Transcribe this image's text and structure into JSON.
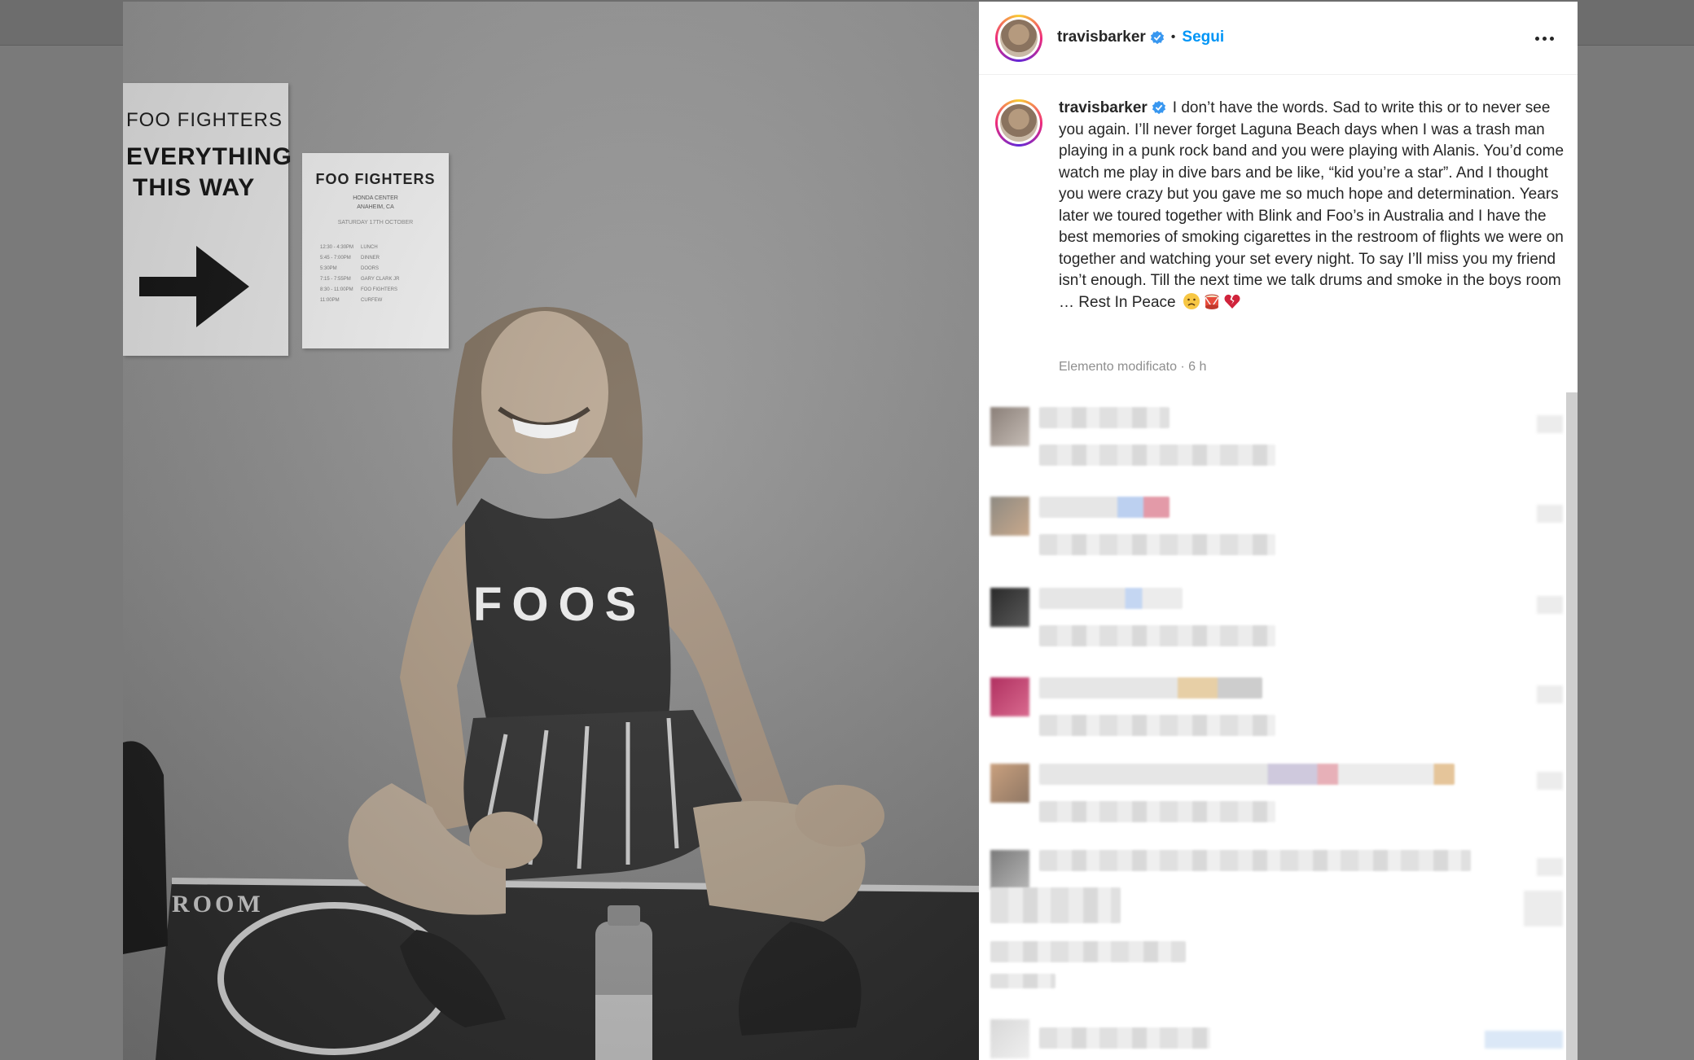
{
  "post": {
    "username": "travisbarker",
    "follow_label": "Segui",
    "separator": "•",
    "caption": "I don’t have the words. Sad to write this or to never see you again. I’ll never forget Laguna Beach days when I was a trash man playing in a punk rock band and you were playing with Alanis. You’d come watch me play in dive bars and be like, “kid you’re a star”. And I thought you were crazy but you gave me so much hope and determination. Years later we toured together with Blink and Foo’s in Australia and I have the best memories of smoking cigarettes in the restroom of flights we were on together and watching your set every night. To say I’ll miss you my friend isn’t enough. Till the next time we talk drums and smoke in the boys room … Rest In Peace",
    "timestamp": "Elemento modificato · 6 h"
  },
  "photo": {
    "poster_left": {
      "band": "FOO FIGHTERS",
      "line2": "EVERYTHING",
      "line3": "THIS WAY"
    },
    "poster_right": {
      "title": "FOO FIGHTERS",
      "venue": "HONDA CENTER",
      "city": "ANAHEIM, CA",
      "date": "SATURDAY 17TH OCTOBER",
      "schedule": [
        {
          "time": "12:30 - 4:30PM",
          "item": "LUNCH"
        },
        {
          "time": "5:45 - 7:00PM",
          "item": "DINNER"
        },
        {
          "time": "5:30PM",
          "item": "DOORS"
        },
        {
          "time": "7:15 - 7:55PM",
          "item": "GARY CLARK JR"
        },
        {
          "time": "8:30 - 11:00PM",
          "item": "FOO FIGHTERS"
        },
        {
          "time": "11:00PM",
          "item": "CURFEW"
        }
      ]
    },
    "shirt_text": "FOOS",
    "floor_text": "ROOM"
  },
  "colors": {
    "accent": "#0095f6",
    "text": "#262626",
    "muted": "#8e8e8e",
    "heart": "#e0245e"
  },
  "comments": {
    "count": 7,
    "note": "blurred"
  }
}
